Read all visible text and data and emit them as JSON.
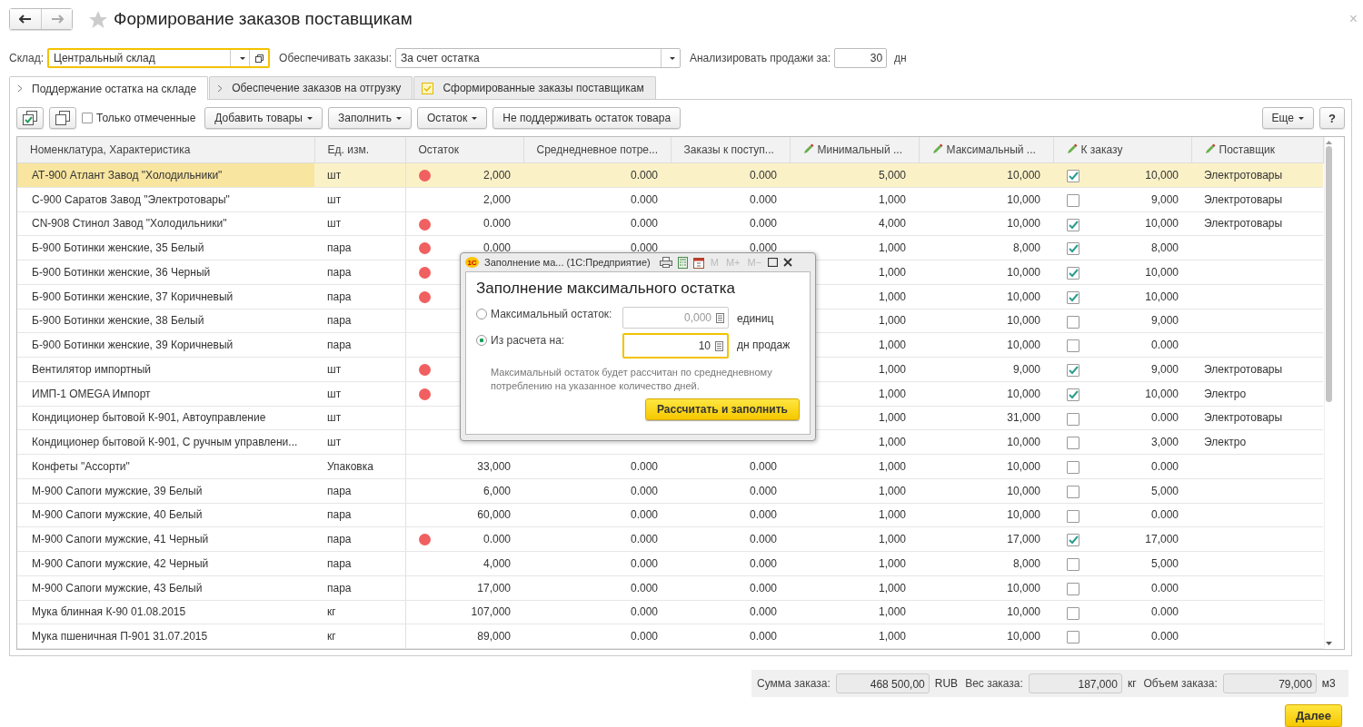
{
  "window": {
    "title": "Формирование заказов поставщикам",
    "close": "×"
  },
  "filters": [
    {
      "kind": "select",
      "label": "Склад:",
      "value": "Центральный склад",
      "focused": true,
      "open_button": true
    },
    {
      "kind": "select",
      "label": "Обеспечивать заказы:",
      "value": "За счет остатка",
      "focused": false,
      "open_button": false
    },
    {
      "kind": "number",
      "label": "Анализировать продажи за:",
      "value": "30",
      "unit": "дн"
    }
  ],
  "tabs": [
    {
      "label": "Поддержание остатка на складе",
      "selected": true,
      "kind": "section"
    },
    {
      "label": "Обеспечение заказов на отгрузку",
      "selected": false,
      "kind": "section"
    },
    {
      "label": "Сформированные заказы поставщикам",
      "selected": false,
      "kind": "result"
    }
  ],
  "toolbar": {
    "only_marked": {
      "label": "Только отмеченные",
      "checked": false
    },
    "buttons": [
      {
        "label": "Добавить товары",
        "dropdown": true
      },
      {
        "label": "Заполнить",
        "dropdown": true
      },
      {
        "label": "Остаток",
        "dropdown": true
      },
      {
        "label": "Не поддерживать остаток товара",
        "dropdown": false
      }
    ],
    "more": {
      "label": "Еще",
      "dropdown": true
    },
    "help": "?"
  },
  "table": {
    "columns": [
      {
        "label": "Номенклатура, Характеристика",
        "editable": false
      },
      {
        "label": "Ед. изм.",
        "editable": false
      },
      {
        "label": "Остаток",
        "editable": false
      },
      {
        "label": "Среднедневное потре...",
        "editable": false
      },
      {
        "label": "Заказы к поступ...",
        "editable": false
      },
      {
        "label": "Минимальный ...",
        "editable": true
      },
      {
        "label": "Максимальный ...",
        "editable": true
      },
      {
        "label": "К заказу",
        "editable": true
      },
      {
        "label": "Поставщик",
        "editable": true
      }
    ],
    "rows": [
      {
        "name": "АТ-900 Атлант Завод \"Холодильники\"",
        "unit": "шт",
        "low_stock": true,
        "stock": "2,000",
        "daily": "0.000",
        "incoming": "0.000",
        "min": "5,000",
        "max": "10,000",
        "checked": true,
        "order": "10,000",
        "supplier": "Электротовары",
        "selected": true
      },
      {
        "name": "С-900 Саратов Завод \"Электротовары\"",
        "unit": "шт",
        "low_stock": false,
        "stock": "2,000",
        "daily": "0.000",
        "incoming": "0.000",
        "min": "1,000",
        "max": "10,000",
        "checked": false,
        "order": "9,000",
        "supplier": "Электротовары",
        "selected": false
      },
      {
        "name": "CN-908 Стинол Завод \"Холодильники\"",
        "unit": "шт",
        "low_stock": true,
        "stock": "0.000",
        "daily": "0.000",
        "incoming": "0.000",
        "min": "4,000",
        "max": "10,000",
        "checked": true,
        "order": "10,000",
        "supplier": "Электротовары",
        "selected": false
      },
      {
        "name": "Б-900 Ботинки женские, 35 Белый",
        "unit": "пара",
        "low_stock": true,
        "stock": "0.000",
        "daily": "0.000",
        "incoming": "0.000",
        "min": "1,000",
        "max": "8,000",
        "checked": true,
        "order": "8,000",
        "selected": false
      },
      {
        "name": "Б-900 Ботинки женские, 36 Черный",
        "unit": "пара",
        "low_stock": true,
        "min": "1,000",
        "max": "10,000",
        "checked": true,
        "order": "10,000",
        "selected": false
      },
      {
        "name": "Б-900 Ботинки женские, 37 Коричневый",
        "unit": "пара",
        "low_stock": true,
        "min": "1,000",
        "max": "10,000",
        "checked": true,
        "order": "10,000",
        "selected": false
      },
      {
        "name": "Б-900 Ботинки женские, 38 Белый",
        "unit": "пара",
        "low_stock": false,
        "min": "1,000",
        "max": "10,000",
        "checked": false,
        "order": "9,000",
        "selected": false
      },
      {
        "name": "Б-900 Ботинки женские, 39 Коричневый",
        "unit": "пара",
        "low_stock": false,
        "min": "1,000",
        "max": "10,000",
        "checked": false,
        "order": "0.000",
        "selected": false
      },
      {
        "name": "Вентилятор импортный",
        "unit": "шт",
        "low_stock": true,
        "min": "1,000",
        "max": "9,000",
        "checked": true,
        "order": "9,000",
        "supplier": "Электротовары",
        "selected": false
      },
      {
        "name": "ИМП-1 OMEGA Импорт",
        "unit": "шт",
        "low_stock": true,
        "min": "1,000",
        "max": "10,000",
        "checked": true,
        "order": "10,000",
        "supplier": "Электро",
        "selected": false
      },
      {
        "name": "Кондиционер бытовой К-901, Автоуправление",
        "unit": "шт",
        "low_stock": false,
        "min": "1,000",
        "max": "31,000",
        "checked": false,
        "order": "0.000",
        "supplier": "Электротовары",
        "selected": false
      },
      {
        "name": "Кондиционер бытовой К-901, С ручным управлени...",
        "unit": "шт",
        "low_stock": false,
        "min": "1,000",
        "max": "10,000",
        "checked": false,
        "order": "3,000",
        "supplier": "Электро",
        "selected": false
      },
      {
        "name": "Конфеты \"Ассорти\"",
        "unit": "Упаковка",
        "low_stock": false,
        "stock": "33,000",
        "daily": "0.000",
        "incoming": "0.000",
        "min": "1,000",
        "max": "10,000",
        "checked": false,
        "order": "0.000",
        "selected": false
      },
      {
        "name": "М-900 Сапоги мужские, 39 Белый",
        "unit": "пара",
        "low_stock": false,
        "stock": "6,000",
        "daily": "0.000",
        "incoming": "0.000",
        "min": "1,000",
        "max": "10,000",
        "checked": false,
        "order": "5,000",
        "selected": false
      },
      {
        "name": "М-900 Сапоги мужские, 40 Белый",
        "unit": "пара",
        "low_stock": false,
        "stock": "60,000",
        "daily": "0.000",
        "incoming": "0.000",
        "min": "1,000",
        "max": "10,000",
        "checked": false,
        "order": "0.000",
        "selected": false
      },
      {
        "name": "М-900 Сапоги мужские, 41 Черный",
        "unit": "пара",
        "low_stock": true,
        "stock": "0.000",
        "daily": "0.000",
        "incoming": "0.000",
        "min": "1,000",
        "max": "17,000",
        "checked": true,
        "order": "17,000",
        "selected": false
      },
      {
        "name": "М-900 Сапоги мужские, 42 Черный",
        "unit": "пара",
        "low_stock": false,
        "stock": "4,000",
        "daily": "0.000",
        "incoming": "0.000",
        "min": "1,000",
        "max": "8,000",
        "checked": false,
        "order": "5,000",
        "selected": false
      },
      {
        "name": "М-900 Сапоги мужские, 43 Белый",
        "unit": "пара",
        "low_stock": false,
        "stock": "17,000",
        "daily": "0.000",
        "incoming": "0.000",
        "min": "1,000",
        "max": "10,000",
        "checked": false,
        "order": "0.000",
        "selected": false
      },
      {
        "name": "Мука блинная  К-90 01.08.2015",
        "unit": "кг",
        "low_stock": false,
        "stock": "107,000",
        "daily": "0.000",
        "incoming": "0.000",
        "min": "1,000",
        "max": "10,000",
        "checked": false,
        "order": "0.000",
        "selected": false
      },
      {
        "name": "Мука пшеничная П-901  31.07.2015",
        "unit": "кг",
        "low_stock": false,
        "stock": "89,000",
        "daily": "0.000",
        "incoming": "0.000",
        "min": "1,000",
        "max": "10,000",
        "checked": false,
        "order": "0.000",
        "selected": false
      }
    ]
  },
  "totals": [
    {
      "label": "Сумма заказа:",
      "value": "468 500,00",
      "unit": "RUB"
    },
    {
      "label": "Вес заказа:",
      "value": "187,000",
      "unit": "кг"
    },
    {
      "label": "Объем заказа:",
      "value": "79,000",
      "unit": "м3"
    }
  ],
  "next_button": "Далее",
  "dialog": {
    "window_title": "Заполнение ма...  (1С:Предприятие)",
    "logo": "1С",
    "memory_buttons": [
      "M",
      "M+",
      "M−"
    ],
    "heading": "Заполнение максимального остатка",
    "options": [
      {
        "label": "Максимальный остаток:",
        "selected": false,
        "value": "0,000",
        "unit": "единиц",
        "disabled": true
      },
      {
        "label": "Из расчета на:",
        "selected": true,
        "value": "10",
        "unit": "дн продаж",
        "disabled": false
      }
    ],
    "note": "Максимальный остаток будет рассчитан по среднедневному потреблению на указанное количество дней.",
    "button": "Рассчитать и заполнить"
  }
}
